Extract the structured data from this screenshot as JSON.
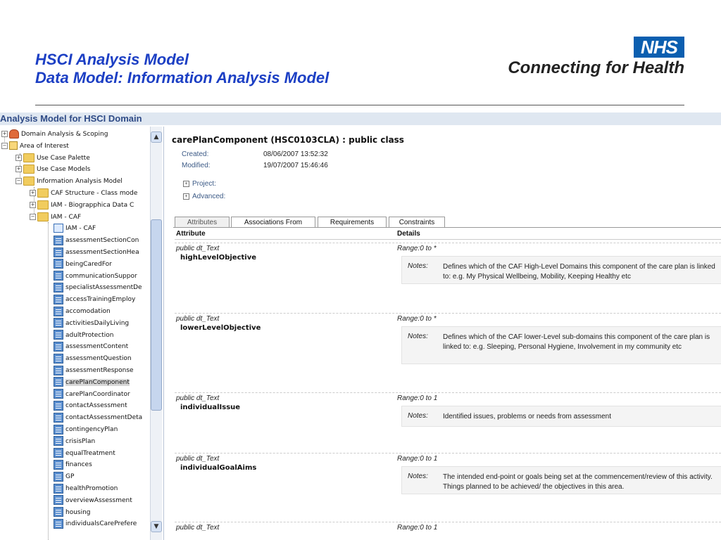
{
  "slide": {
    "title_line1": "HSCI Analysis Model",
    "title_line2": "Data Model: Information Analysis Model",
    "logo_nhs": "NHS",
    "logo_tagline": "Connecting for Health"
  },
  "app": {
    "title": "Analysis Model for HSCI Domain"
  },
  "tree": {
    "nodes": [
      {
        "label": "Domain Analysis & Scoping",
        "icon": "package-icon",
        "expander": "+"
      },
      {
        "label": "Area of Interest",
        "icon": "list-icon",
        "expander": "-"
      },
      {
        "label": "Use Case Palette",
        "icon": "folder-icon",
        "expander": "+"
      },
      {
        "label": "Use Case Models",
        "icon": "folder-icon",
        "expander": "+"
      },
      {
        "label": "Information Analysis Model",
        "icon": "folder-icon",
        "expander": "-"
      },
      {
        "label": "CAF Structure - Class mode",
        "icon": "folder-icon",
        "expander": "+"
      },
      {
        "label": "IAM - Biograpphica Data C",
        "icon": "folder-icon",
        "expander": "+"
      },
      {
        "label": "IAM - CAF",
        "icon": "folder-icon",
        "expander": "-"
      },
      {
        "label": "IAM - CAF",
        "icon": "diagram-icon",
        "expander": ""
      },
      {
        "label": "assessmentSectionCon",
        "icon": "class-icon",
        "expander": ""
      },
      {
        "label": "assessmentSectionHea",
        "icon": "class-icon",
        "expander": ""
      },
      {
        "label": "beingCaredFor",
        "icon": "class-icon",
        "expander": ""
      },
      {
        "label": "communicationSuppor",
        "icon": "class-icon",
        "expander": ""
      },
      {
        "label": "specialistAssessmentDe",
        "icon": "class-icon",
        "expander": ""
      },
      {
        "label": "accessTrainingEmploy",
        "icon": "class-icon",
        "expander": ""
      },
      {
        "label": "accomodation",
        "icon": "class-icon",
        "expander": ""
      },
      {
        "label": "activitiesDailyLiving",
        "icon": "class-icon",
        "expander": ""
      },
      {
        "label": "adultProtection",
        "icon": "class-icon",
        "expander": ""
      },
      {
        "label": "assessmentContent",
        "icon": "class-icon",
        "expander": ""
      },
      {
        "label": "assessmentQuestion",
        "icon": "class-icon",
        "expander": ""
      },
      {
        "label": "assessmentResponse",
        "icon": "class-icon",
        "expander": ""
      },
      {
        "label": "carePlanComponent",
        "icon": "class-icon",
        "expander": ""
      },
      {
        "label": "carePlanCoordinator",
        "icon": "class-icon",
        "expander": ""
      },
      {
        "label": "contactAssessment",
        "icon": "class-icon",
        "expander": ""
      },
      {
        "label": "contactAssessmentDeta",
        "icon": "class-icon",
        "expander": ""
      },
      {
        "label": "contingencyPlan",
        "icon": "class-icon",
        "expander": ""
      },
      {
        "label": "crisisPlan",
        "icon": "class-icon",
        "expander": ""
      },
      {
        "label": "equalTreatment",
        "icon": "class-icon",
        "expander": ""
      },
      {
        "label": "finances",
        "icon": "class-icon",
        "expander": ""
      },
      {
        "label": "GP",
        "icon": "class-icon",
        "expander": ""
      },
      {
        "label": "healthPromotion",
        "icon": "class-icon",
        "expander": ""
      },
      {
        "label": "overviewAssessment",
        "icon": "class-icon",
        "expander": ""
      },
      {
        "label": "housing",
        "icon": "class-icon",
        "expander": ""
      },
      {
        "label": "individualsCarePrefere",
        "icon": "class-icon",
        "expander": ""
      }
    ],
    "selected_label": "carePlanComponent"
  },
  "detail": {
    "class_title": "carePlanComponent (HSC0103CLA) : public class",
    "created_label": "Created:",
    "created_value": "08/06/2007 13:52:32",
    "modified_label": "Modified:",
    "modified_value": "19/07/2007 15:46:46",
    "project_label": "Project:",
    "advanced_label": "Advanced:",
    "tabs": [
      "Attributes",
      "Associations From",
      "Requirements",
      "Constraints"
    ],
    "active_tab": "Attributes",
    "col_attribute": "Attribute",
    "col_details": "Details",
    "notes_label": "Notes:",
    "attributes": [
      {
        "type": "public dt_Text",
        "name": "highLevelObjective",
        "range": "Range:0 to *",
        "notes": "Defines which of the CAF High-Level Domains this component of the care plan is linked to: e.g. My Physical Wellbeing, Mobility, Keeping Healthy etc"
      },
      {
        "type": "public dt_Text",
        "name": "lowerLevelObjective",
        "range": "Range:0 to *",
        "notes": "Defines which of the CAF lower-Level sub-domains this component of the care plan is linked to: e.g. Sleeping, Personal Hygiene, Involvement in my community etc"
      },
      {
        "type": "public dt_Text",
        "name": "individualIssue",
        "range": "Range:0 to 1",
        "notes": "Identified issues, problems or needs from assessment"
      },
      {
        "type": "public dt_Text",
        "name": "individualGoalAims",
        "range": "Range:0 to 1",
        "notes": "The intended end-point or goals being set at the commencement/review of this activity. Things planned to be achieved/ the objectives in this area."
      },
      {
        "type": "public dt_Text",
        "name": "",
        "range": "Range:0 to 1",
        "notes": ""
      }
    ]
  },
  "colors": {
    "title_blue": "#1c3fc4",
    "nhs_blue": "#0b5fb0",
    "app_bar": "#dfe7f1"
  }
}
